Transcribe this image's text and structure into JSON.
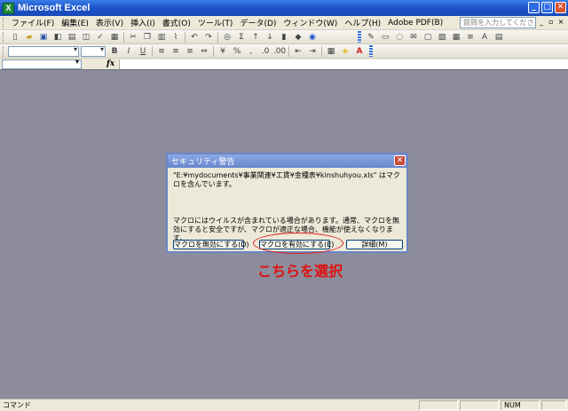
{
  "window": {
    "title": "Microsoft Excel",
    "app_icon_letter": "X"
  },
  "menu": {
    "items": [
      "ファイル(F)",
      "編集(E)",
      "表示(V)",
      "挿入(I)",
      "書式(O)",
      "ツール(T)",
      "データ(D)",
      "ウィンドウ(W)",
      "ヘルプ(H)",
      "Adobe PDF(B)"
    ],
    "help_placeholder": "質問を入力してください"
  },
  "dialog": {
    "title": "セキュリティ警告",
    "file_message": "\"E:¥mydocuments¥事業関連¥工賃¥金種表¥kinshuhyou.xls\" はマクロを含んでいます。",
    "warning_message": "マクロにはウイルスが含まれている場合があります。通常、マクロを無効にすると安全ですが、マクロが適正な場合、機能が使えなくなります。",
    "buttons": {
      "disable": "マクロを無効にする(D)",
      "enable": "マクロを有効にする(E)",
      "detail": "詳細(M)"
    }
  },
  "annotation": {
    "text": "こちらを選択",
    "color": "#e01010"
  },
  "status": {
    "left": "コマンド",
    "num": "NUM"
  }
}
